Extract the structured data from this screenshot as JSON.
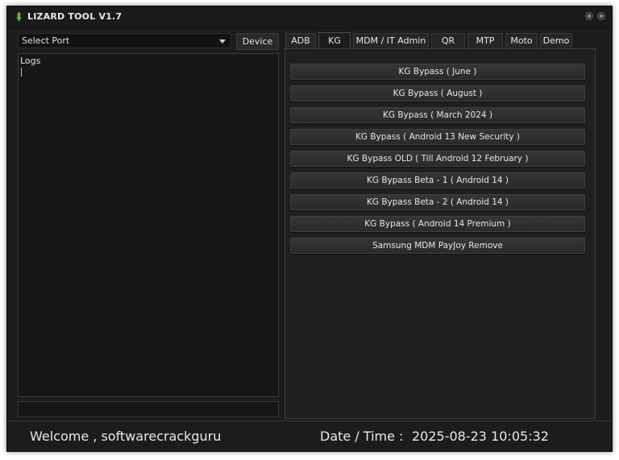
{
  "window": {
    "title": "LIZARD TOOL V1.7"
  },
  "port": {
    "selected": "Select Port",
    "device_label": "Device"
  },
  "logs": {
    "label": "Logs"
  },
  "tabs": [
    {
      "label": "ADB",
      "active": false
    },
    {
      "label": "KG",
      "active": true
    },
    {
      "label": "MDM / IT Admin",
      "active": false
    },
    {
      "label": "QR",
      "active": false
    },
    {
      "label": "MTP",
      "active": false
    },
    {
      "label": "Moto",
      "active": false
    },
    {
      "label": "Demo",
      "active": false
    }
  ],
  "kg_buttons": [
    "KG Bypass ( June )",
    "KG Bypass  ( August )",
    "KG Bypass ( March 2024 )",
    "KG Bypass ( Android 13 New Security )",
    "KG Bypass OLD ( Till Android 12 February )",
    "KG Bypass Beta - 1 ( Android 14  )",
    "KG Bypass Beta - 2 ( Android 14  )",
    "KG Bypass ( Android 14  Premium )",
    "Samsung MDM PayJoy Remove"
  ],
  "status": {
    "welcome": "Welcome , softwarecrackguru",
    "datetime_label": "Date / Time :",
    "datetime_value": "2025-08-23 10:05:32"
  },
  "icons": {
    "app": "lizard-icon",
    "minimize": "minimize-icon",
    "close": "close-icon",
    "dropdown": "chevron-down-icon"
  },
  "colors": {
    "background": "#1c1c1c",
    "panel": "#1f1f1f",
    "text": "#e6e6e6",
    "lizard": "#6fb03a"
  }
}
